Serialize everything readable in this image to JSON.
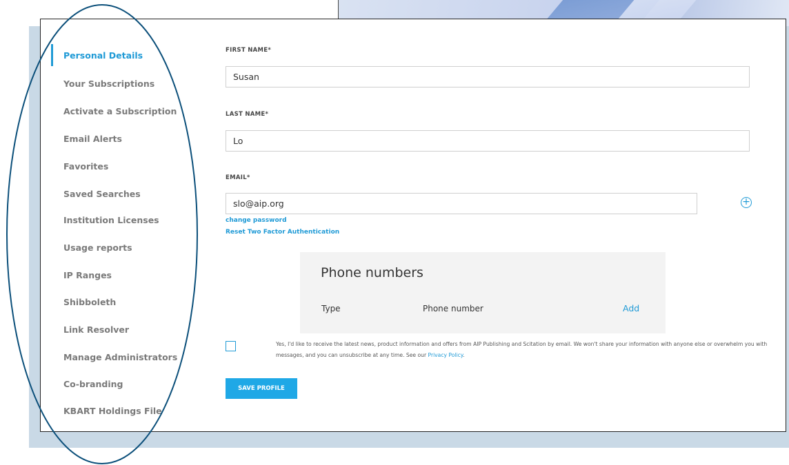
{
  "sidebar": {
    "items": [
      {
        "label": "Personal Details",
        "active": true
      },
      {
        "label": "Your Subscriptions"
      },
      {
        "label": "Activate a Subscription"
      },
      {
        "label": "Email Alerts"
      },
      {
        "label": "Favorites"
      },
      {
        "label": "Saved Searches"
      },
      {
        "label": "Institution Licenses"
      },
      {
        "label": "Usage reports"
      },
      {
        "label": "IP Ranges"
      },
      {
        "label": "Shibboleth"
      },
      {
        "label": "Link Resolver"
      },
      {
        "label": "Manage Administrators"
      },
      {
        "label": "Co-branding"
      },
      {
        "label": "KBART Holdings File"
      }
    ]
  },
  "form": {
    "first_name_label": "FIRST NAME*",
    "first_name_value": "Susan",
    "last_name_label": "LAST NAME*",
    "last_name_value": "Lo",
    "email_label": "EMAIL*",
    "email_value": "slo@aip.org",
    "change_password": "change password",
    "reset_2fa": "Reset Two Factor Authentication"
  },
  "phone": {
    "title": "Phone numbers",
    "col_type": "Type",
    "col_number": "Phone number",
    "add": "Add"
  },
  "consent": {
    "text": "Yes, I'd like to receive the latest news, product information and offers from AIP Publishing and Scitation by email. We won't share your information with anyone else or overwhelm you with messages, and you can unsubscribe at any time. See our ",
    "policy_link": "Privacy Policy",
    "end": ".",
    "checked": false
  },
  "save_button": "SAVE PROFILE",
  "colors": {
    "accent": "#1f9ad6",
    "annotation": "#0b4f7a"
  }
}
